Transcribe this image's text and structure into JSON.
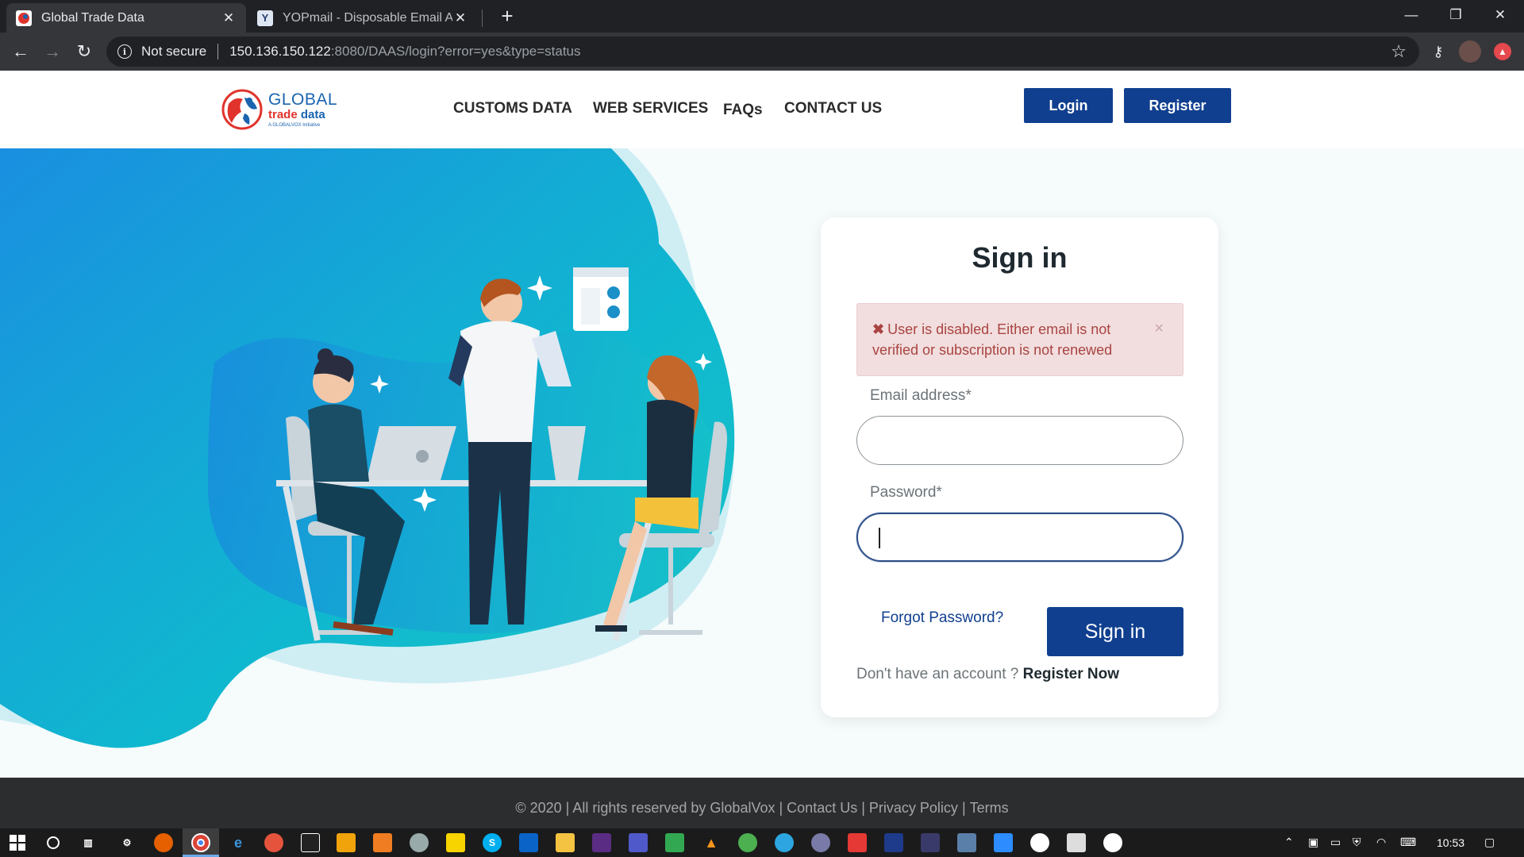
{
  "browser": {
    "tabs": [
      {
        "title": "Global Trade Data",
        "active": true,
        "favicon": "globe-icon"
      },
      {
        "title": "YOPmail - Disposable Email Addr",
        "active": false,
        "favicon": "yopmail-icon"
      }
    ],
    "security_label": "Not secure",
    "url_host": "150.136.150.122",
    "url_path": ":8080/DAAS/login?error=yes&type=status"
  },
  "header": {
    "logo": {
      "line1": "GLOBAL",
      "line2a": "trade",
      "line2b": "data",
      "line3": "A GLOBALVOX Initiative"
    },
    "nav": [
      "CUSTOMS DATA",
      "WEB SERVICES",
      "FAQs",
      "CONTACT US"
    ],
    "login_label": "Login",
    "register_label": "Register"
  },
  "signin": {
    "title": "Sign in",
    "alert_text": "User is disabled. Either email is not verified or subscription is not renewed",
    "alert_close": "×",
    "email_label": "Email address*",
    "email_value": "",
    "password_label": "Password*",
    "password_value": "",
    "forgot_label": "Forgot Password?",
    "submit_label": "Sign in",
    "no_account_text": "Don't have an account ?",
    "register_now_label": "Register Now"
  },
  "footer": {
    "copyright": "© 2020 | All rights reserved by GlobalVox",
    "contact": "Contact Us",
    "privacy": "Privacy Policy",
    "terms": "Terms"
  },
  "taskbar": {
    "clock": "10:53",
    "accent": "#6aa9e8"
  },
  "colors": {
    "brand_blue": "#103f8f",
    "alert_bg": "#f2dede",
    "alert_text": "#a94442",
    "teal": "#19b6c9"
  }
}
